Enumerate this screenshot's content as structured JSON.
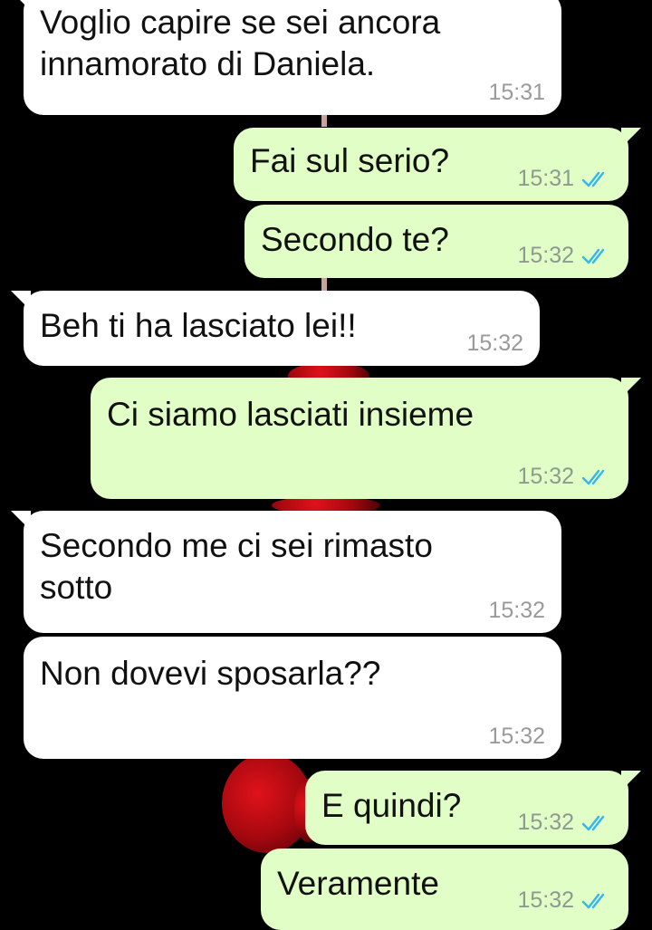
{
  "colors": {
    "incoming_bubble": "#ffffff",
    "outgoing_bubble": "#e1fec6",
    "read_ticks": "#34b7f1",
    "background": "#000000"
  },
  "messages": [
    {
      "direction": "incoming",
      "text": "Voglio capire se sei ancora\ninnamorato di Daniela.",
      "time": "15:31"
    },
    {
      "direction": "outgoing",
      "text": "Fai sul serio?",
      "time": "15:31",
      "status_icon": "double-check-read-icon"
    },
    {
      "direction": "outgoing",
      "text": "Secondo te?",
      "time": "15:32",
      "status_icon": "double-check-read-icon"
    },
    {
      "direction": "incoming",
      "text": "Beh ti ha lasciato lei!!",
      "time": "15:32"
    },
    {
      "direction": "outgoing",
      "text": "Ci siamo lasciati insieme",
      "time": "15:32",
      "status_icon": "double-check-read-icon"
    },
    {
      "direction": "incoming",
      "text": "Secondo me ci sei rimasto\nsotto",
      "time": "15:32"
    },
    {
      "direction": "incoming",
      "text": "Non dovevi sposarla??",
      "time": "15:32"
    },
    {
      "direction": "outgoing",
      "text": "E quindi?",
      "time": "15:32",
      "status_icon": "double-check-read-icon"
    },
    {
      "direction": "outgoing",
      "text": "Veramente",
      "time": "15:32",
      "status_icon": "double-check-read-icon"
    }
  ]
}
